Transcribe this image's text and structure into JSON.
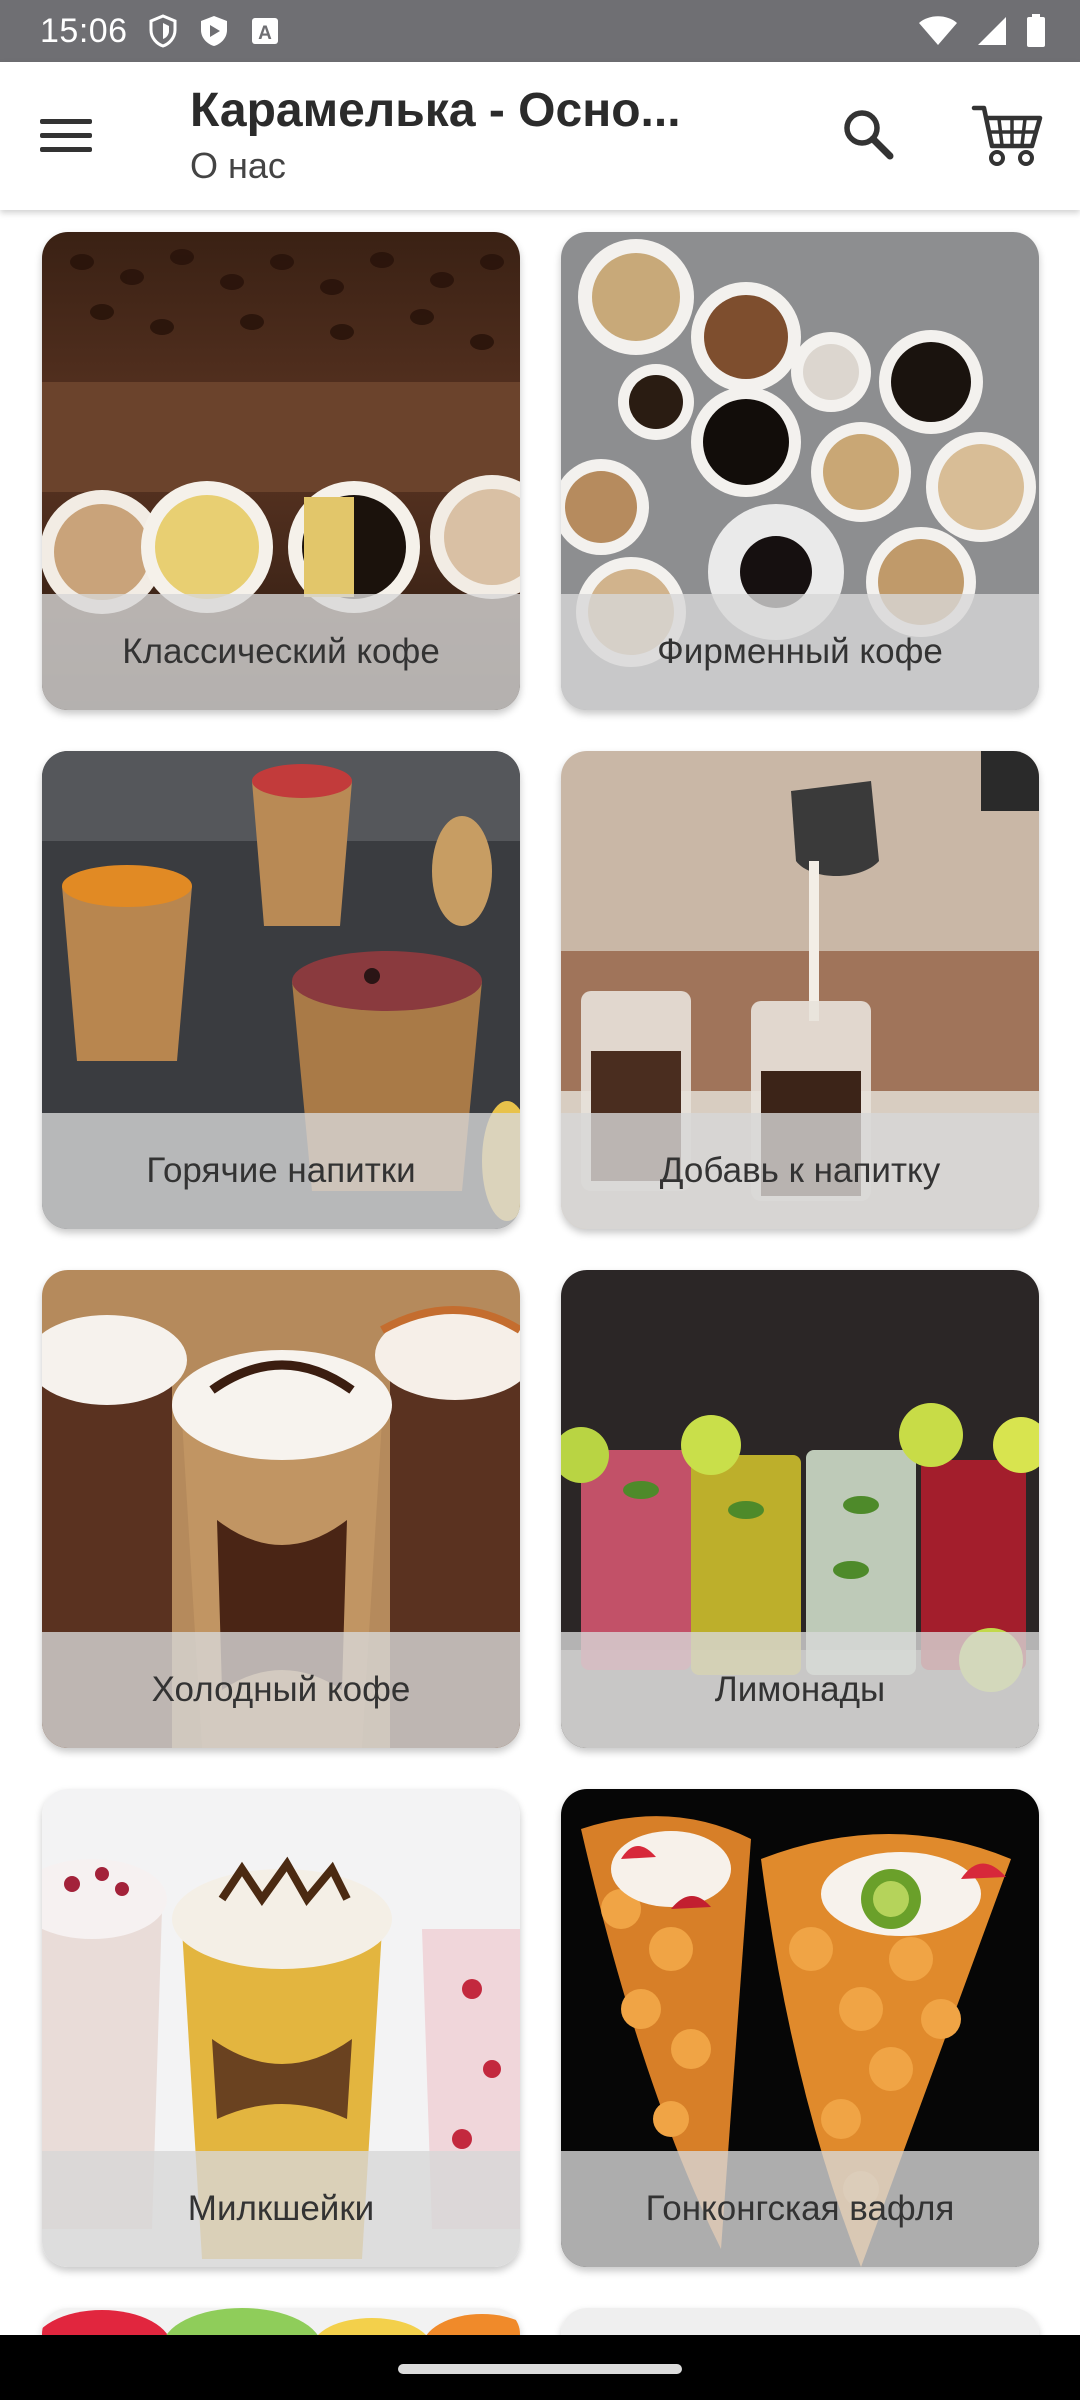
{
  "status_bar": {
    "time": "15:06",
    "icons": [
      "shield-icon",
      "play-protect-icon",
      "keyboard-a-icon",
      "wifi-icon",
      "signal-icon",
      "battery-icon"
    ]
  },
  "app_bar": {
    "title": "Карамелька - Осно...",
    "subtitle": "О нас",
    "menu_icon": "hamburger-menu-icon",
    "search_icon": "search-icon",
    "cart_icon": "shopping-cart-icon"
  },
  "categories": [
    {
      "label": "Классический кофе",
      "image": "coffee-beans-cups-photo"
    },
    {
      "label": "Фирменный кофе",
      "image": "coffee-cups-top-view-photo"
    },
    {
      "label": "Горячие напитки",
      "image": "hot-drinks-paper-cups-photo"
    },
    {
      "label": "Добавь к напитку",
      "image": "milk-pouring-photo"
    },
    {
      "label": "Холодный кофе",
      "image": "iced-coffee-whipped-cream-photo"
    },
    {
      "label": "Лимонады",
      "image": "lemonade-glasses-photo"
    },
    {
      "label": "Милкшейки",
      "image": "milkshakes-photo"
    },
    {
      "label": "Гонконгская вафля",
      "image": "bubble-waffle-photo"
    }
  ],
  "colors": {
    "status_bar": "#6f6f73",
    "caption_overlay": "#d7d7d7",
    "nav_bar": "#000000"
  }
}
